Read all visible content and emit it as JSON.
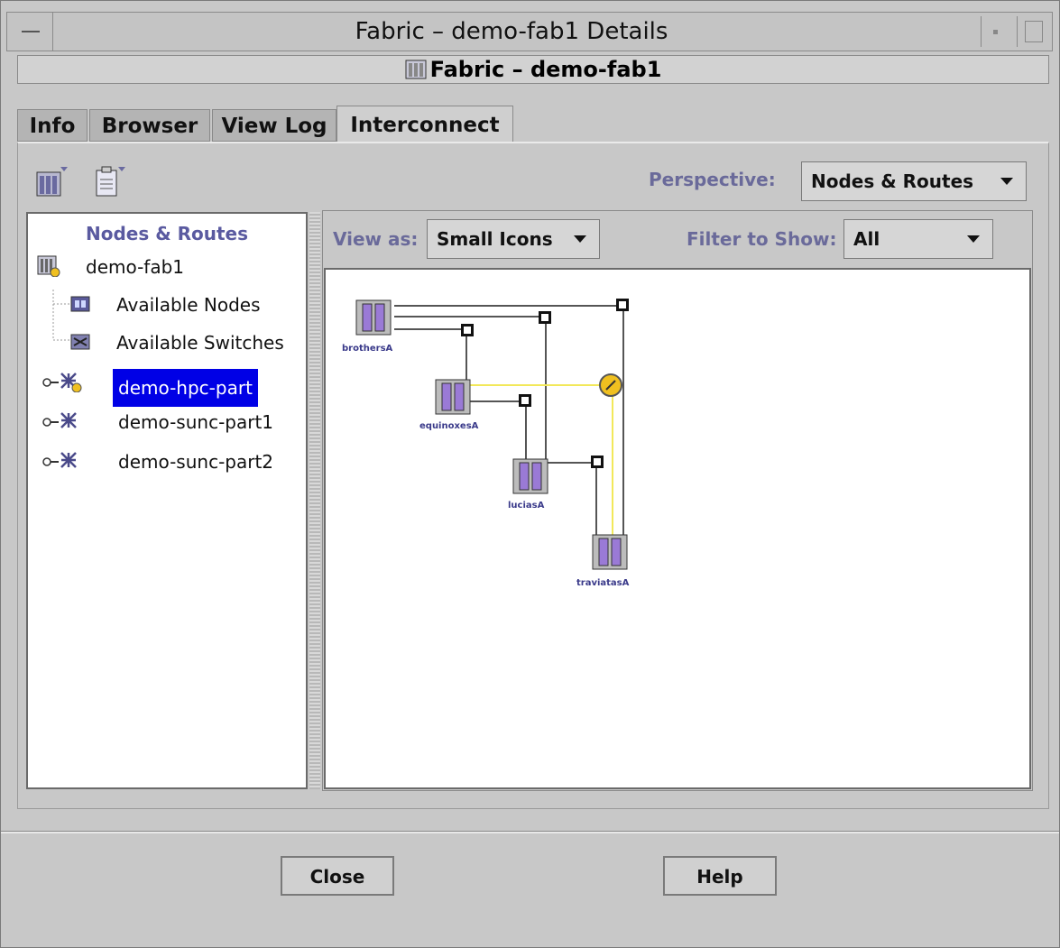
{
  "window": {
    "title": "Fabric – demo-fab1 Details"
  },
  "header": {
    "title": "Fabric – demo-fab1"
  },
  "tabs": [
    {
      "label": "Info"
    },
    {
      "label": "Browser"
    },
    {
      "label": "View Log"
    },
    {
      "label": "Interconnect",
      "active": true
    }
  ],
  "toolbar": {
    "perspective_label": "Perspective:",
    "perspective_value": "Nodes & Routes"
  },
  "tree": {
    "title": "Nodes & Routes",
    "items": [
      {
        "label": "demo-fab1",
        "icon": "fabric-icon"
      },
      {
        "label": "Available Nodes",
        "icon": "nodes-icon"
      },
      {
        "label": "Available Switches",
        "icon": "switches-icon"
      },
      {
        "label": "demo-hpc-part",
        "icon": "partition-icon",
        "selected": true
      },
      {
        "label": "demo-sunc-part1",
        "icon": "partition-icon"
      },
      {
        "label": "demo-sunc-part2",
        "icon": "partition-icon"
      }
    ]
  },
  "view": {
    "view_as_label": "View as:",
    "view_as_value": "Small Icons",
    "filter_label": "Filter to Show:",
    "filter_value": "All"
  },
  "topology": {
    "nodes": [
      "brothersA",
      "equinoxesA",
      "luciasA",
      "traviatasA"
    ]
  },
  "buttons": {
    "close": "Close",
    "help": "Help"
  },
  "colors": {
    "selection": "#0000e6",
    "route_highlight": "#f2e85a",
    "node_purple": "#9a7ad6"
  }
}
